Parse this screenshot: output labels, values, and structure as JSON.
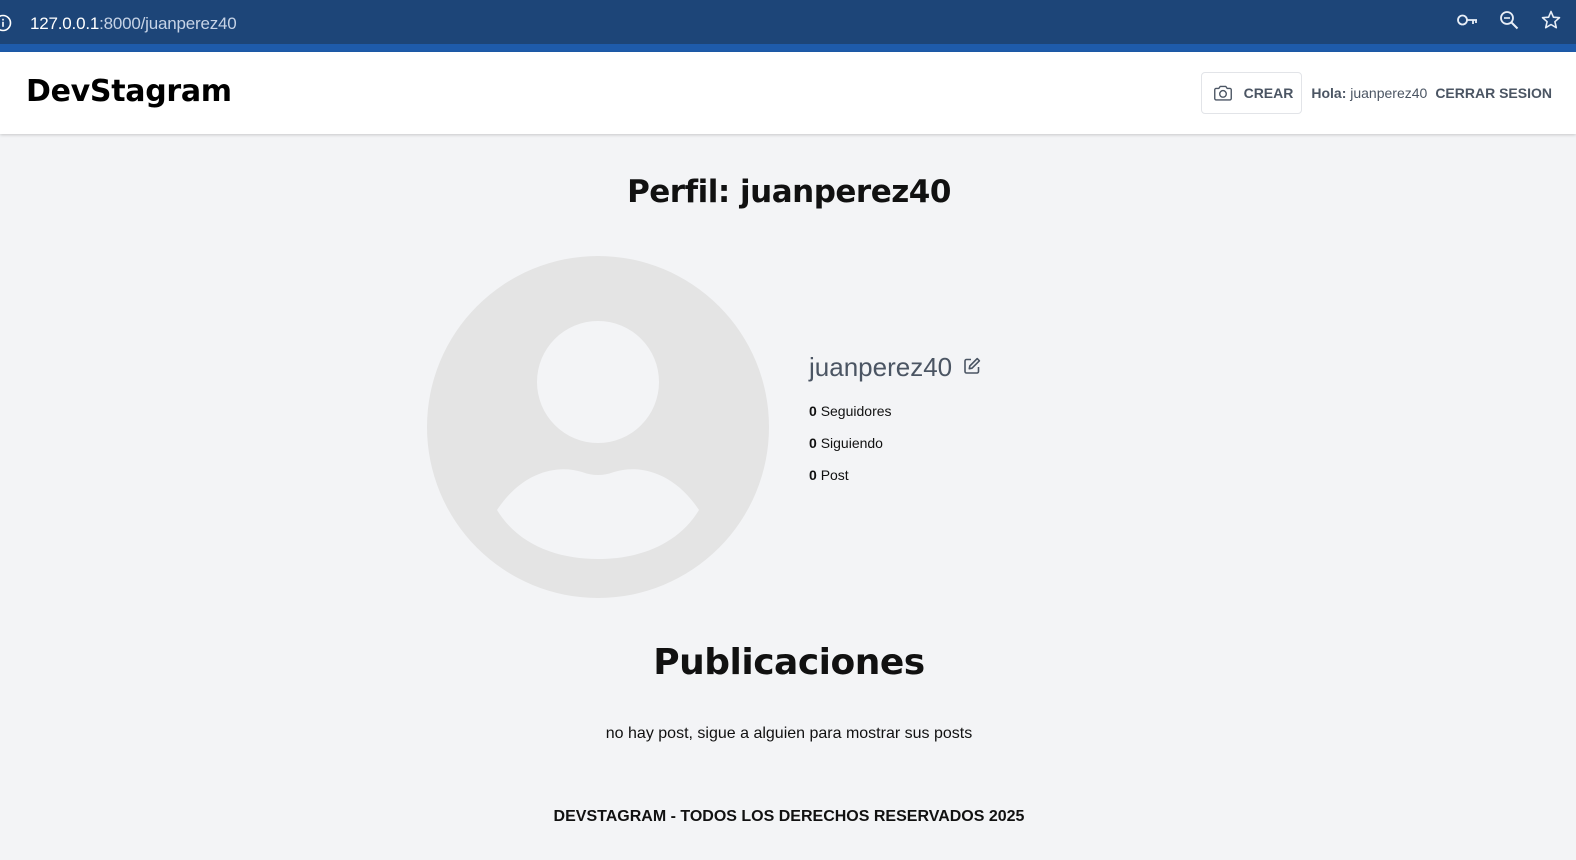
{
  "browser": {
    "url_host": "127.0.0.1",
    "url_path": ":8000/juanperez40",
    "icons": [
      "info-icon",
      "key-icon",
      "zoom-icon",
      "star-icon"
    ]
  },
  "header": {
    "logo": "DevStagram",
    "create_label": "CREAR",
    "greeting_label": "Hola:",
    "greeting_user": "juanperez40",
    "logout_label": "CERRAR SESION"
  },
  "profile": {
    "title": "Perfil: juanperez40",
    "username": "juanperez40",
    "stats": [
      {
        "count": "0",
        "label": "Seguidores"
      },
      {
        "count": "0",
        "label": "Siguiendo"
      },
      {
        "count": "0",
        "label": "Post"
      }
    ]
  },
  "posts": {
    "title": "Publicaciones",
    "empty_message": "no hay post, sigue a alguien para mostrar sus posts"
  },
  "footer": {
    "text": "DEVSTAGRAM - TODOS LOS DERECHOS RESERVADOS 2025"
  },
  "colors": {
    "browser_bar": "#1d4578",
    "page_bg": "#f3f4f6",
    "avatar_bg": "#e4e4e4"
  }
}
